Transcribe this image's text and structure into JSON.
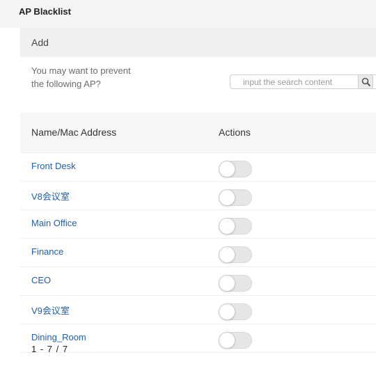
{
  "header": {
    "title": "AP Blacklist"
  },
  "panel": {
    "add_label": "Add",
    "hint_line1": "You may want to prevent",
    "hint_line2": "the following AP?",
    "search": {
      "placeholder": "input the search content",
      "icon": "magnifier-icon"
    }
  },
  "table": {
    "columns": [
      "Name/Mac Address",
      "Actions"
    ],
    "rows": [
      {
        "name": "Front Desk",
        "enabled": false
      },
      {
        "name": "V8会议室",
        "enabled": false
      },
      {
        "name": "Main Office",
        "enabled": false
      },
      {
        "name": "Finance",
        "enabled": false
      },
      {
        "name": "CEO",
        "enabled": false
      },
      {
        "name": "V9会议室",
        "enabled": false
      },
      {
        "name": "Dining_Room",
        "enabled": false
      }
    ]
  },
  "pagination": {
    "label": "1 - 7 / 7"
  },
  "colors": {
    "link": "#1f5fae",
    "header_bg": "#f5f5f5",
    "toggle_off": "#e6e6e6"
  }
}
